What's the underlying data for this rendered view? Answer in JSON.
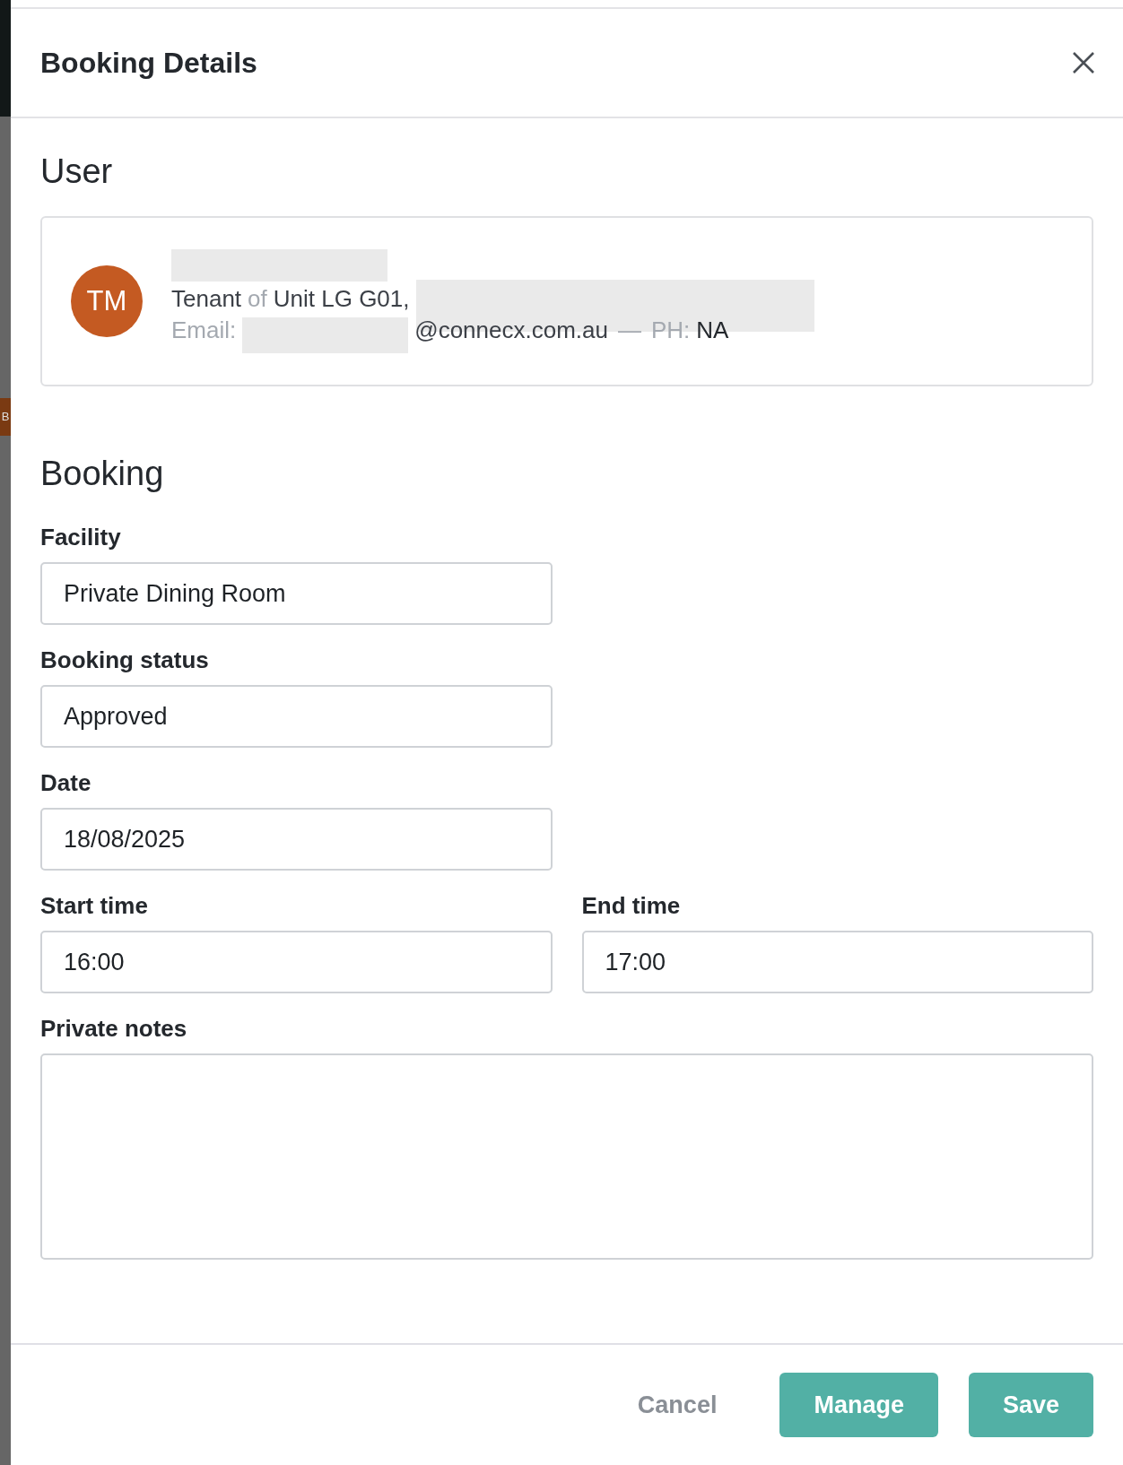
{
  "backdrop": {
    "tab_label": "B"
  },
  "dialog": {
    "title": "Booking Details"
  },
  "user_section": {
    "heading": "User",
    "avatar_initials": "TM",
    "role": "Tenant",
    "connector": "of",
    "unit": "Unit LG G01,",
    "email_label": "Email:",
    "email_domain": "@connecx.com.au",
    "separator": "—",
    "phone_label": "PH:",
    "phone": "NA"
  },
  "booking_section": {
    "heading": "Booking",
    "fields": [
      {
        "label": "Facility",
        "value": "Private Dining Room",
        "kind": "full"
      },
      {
        "label": "Booking status",
        "value": "Approved",
        "kind": "full"
      },
      {
        "label": "Date",
        "value": "18/08/2025",
        "kind": "full"
      },
      {
        "label": "Start time",
        "value": "16:00",
        "kind": "half"
      },
      {
        "label": "End time",
        "value": "17:00",
        "kind": "half"
      },
      {
        "label": "Private notes",
        "kind": "textarea"
      }
    ]
  },
  "buttons": [
    {
      "label": "Cancel",
      "kind": "text"
    },
    {
      "label": "Manage",
      "kind": "primary"
    },
    {
      "label": "Save",
      "kind": "primary"
    }
  ]
}
